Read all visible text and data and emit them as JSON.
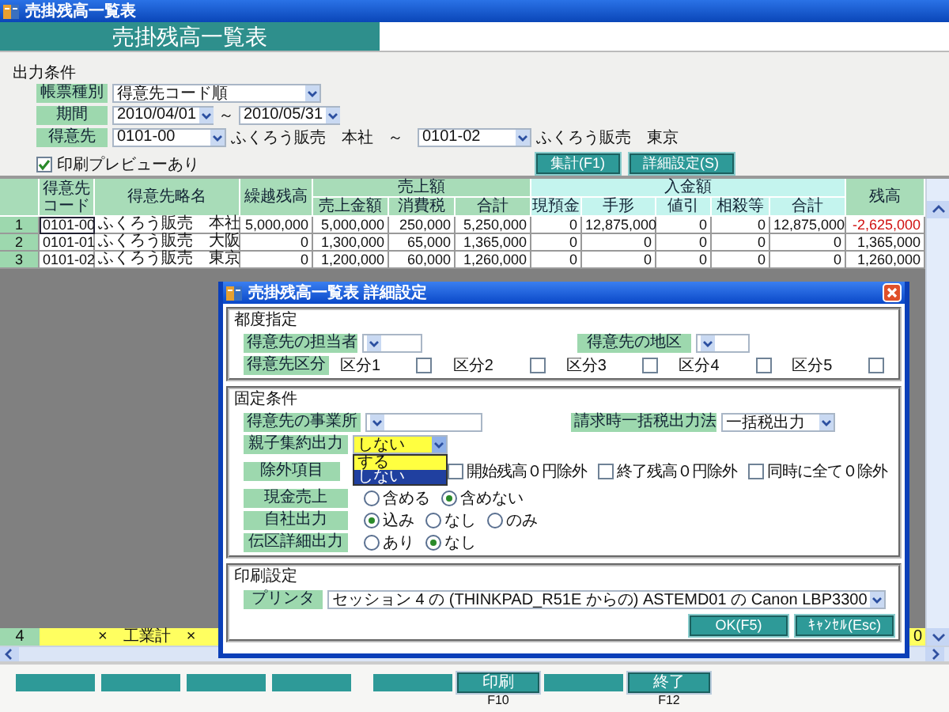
{
  "window": {
    "title": "売掛残高一覧表"
  },
  "header": {
    "title": "売掛残高一覧表"
  },
  "conditions": {
    "title": "出力条件",
    "report_type": {
      "label": "帳票種別",
      "value": "得意先コード順"
    },
    "period": {
      "label": "期間",
      "from": "2010/04/01",
      "separator": "～",
      "to": "2010/05/31"
    },
    "customer": {
      "label": "得意先",
      "from": "0101-00",
      "from_name": "ふくろう販売　本社",
      "separator": "～",
      "to": "0101-02",
      "to_name": "ふくろう販売　東京"
    },
    "print_preview": {
      "label": "印刷プレビューあり",
      "checked": true
    },
    "buttons": [
      "集計(F1)",
      "詳細設定(S)"
    ]
  },
  "table": {
    "columns": [
      {
        "label": "得意先コード"
      },
      {
        "label": "得意先略名"
      },
      {
        "label": "繰越残高"
      },
      {
        "label": "売上額",
        "color": "#a8dcb8",
        "columns": [
          "売上金額",
          "消費税",
          "合計"
        ]
      },
      {
        "label": "入金額",
        "color": "#c4f4ee",
        "columns": [
          "現預金",
          "手形",
          "値引",
          "相殺等",
          "合計"
        ]
      },
      {
        "label": "残高"
      }
    ],
    "rows": [
      {
        "number": "1",
        "code": "0101-00",
        "name": "ふくろう販売　本社",
        "focused": true,
        "negative_balance": true,
        "values": [
          "5,000,000",
          "5,000,000",
          "250,000",
          "5,250,000",
          "0",
          "12,875,000",
          "0",
          "0",
          "12,875,000",
          "-2,625,000"
        ]
      },
      {
        "number": "2",
        "code": "0101-01",
        "name": "ふくろう販売　大阪",
        "focused": false,
        "negative_balance": false,
        "values": [
          "0",
          "1,300,000",
          "65,000",
          "1,365,000",
          "0",
          "0",
          "0",
          "0",
          "0",
          "1,365,000"
        ]
      },
      {
        "number": "3",
        "code": "0101-02",
        "name": "ふくろう販売　東京",
        "focused": false,
        "negative_balance": false,
        "values": [
          "0",
          "1,200,000",
          "60,000",
          "1,260,000",
          "0",
          "0",
          "0",
          "0",
          "0",
          "1,260,000"
        ]
      }
    ],
    "total": {
      "number": "4",
      "label": "×　工業計　×",
      "balance": "0"
    }
  },
  "function_buttons": [
    {
      "enabled": false
    },
    {
      "enabled": false
    },
    {
      "enabled": false
    },
    {
      "enabled": false
    },
    {
      "enabled": false
    },
    {
      "enabled": true,
      "label": "印刷",
      "key": "F10"
    },
    {
      "enabled": false
    },
    {
      "enabled": true,
      "label": "終了",
      "key": "F12"
    }
  ],
  "dialog": {
    "title": "売掛残高一覧表 詳細設定",
    "adhoc": {
      "title": "都度指定",
      "rep": {
        "label": "得意先の担当者"
      },
      "area": {
        "label": "得意先の地区"
      },
      "category": {
        "label": "得意先区分",
        "options": [
          {
            "label": "区分1",
            "checked": false
          },
          {
            "label": "区分2",
            "checked": false
          },
          {
            "label": "区分3",
            "checked": false
          },
          {
            "label": "区分4",
            "checked": false
          },
          {
            "label": "区分5",
            "checked": false
          }
        ]
      }
    },
    "fixed": {
      "title": "固定条件",
      "office": {
        "label": "得意先の事業所"
      },
      "tax_method": {
        "label": "請求時一括税出力法",
        "value": "一括税出力"
      },
      "consolidation": {
        "label": "親子集約出力",
        "value": "しない",
        "focused": true,
        "expanded": true,
        "options": [
          {
            "label": "する",
            "selected": false
          },
          {
            "label": "しない",
            "selected": true
          }
        ]
      },
      "exclusions": {
        "label": "除外項目",
        "options": [
          {
            "label": "開始残高０円除外",
            "checked": false
          },
          {
            "label": "終了残高０円除外",
            "checked": false
          },
          {
            "label": "同時に全て０除外",
            "checked": false
          }
        ]
      },
      "radio_groups": [
        {
          "label": "現金売上",
          "options": [
            {
              "label": "含める",
              "selected": false
            },
            {
              "label": "含めない",
              "selected": true
            }
          ]
        },
        {
          "label": "自社出力",
          "options": [
            {
              "label": "込み",
              "selected": true
            },
            {
              "label": "なし",
              "selected": false
            },
            {
              "label": "のみ",
              "selected": false
            }
          ]
        },
        {
          "label": "伝区詳細出力",
          "options": [
            {
              "label": "あり",
              "selected": false
            },
            {
              "label": "なし",
              "selected": true
            }
          ]
        }
      ]
    },
    "print": {
      "title": "印刷設定",
      "printer": {
        "label": "プリンタ",
        "value": "セッション 4 の (THINKPAD_R51E からの) ASTEMD01 の Canon LBP3300"
      }
    },
    "buttons": [
      "OK(F5)",
      "ｷｬﾝｾﾙ(Esc)"
    ]
  }
}
